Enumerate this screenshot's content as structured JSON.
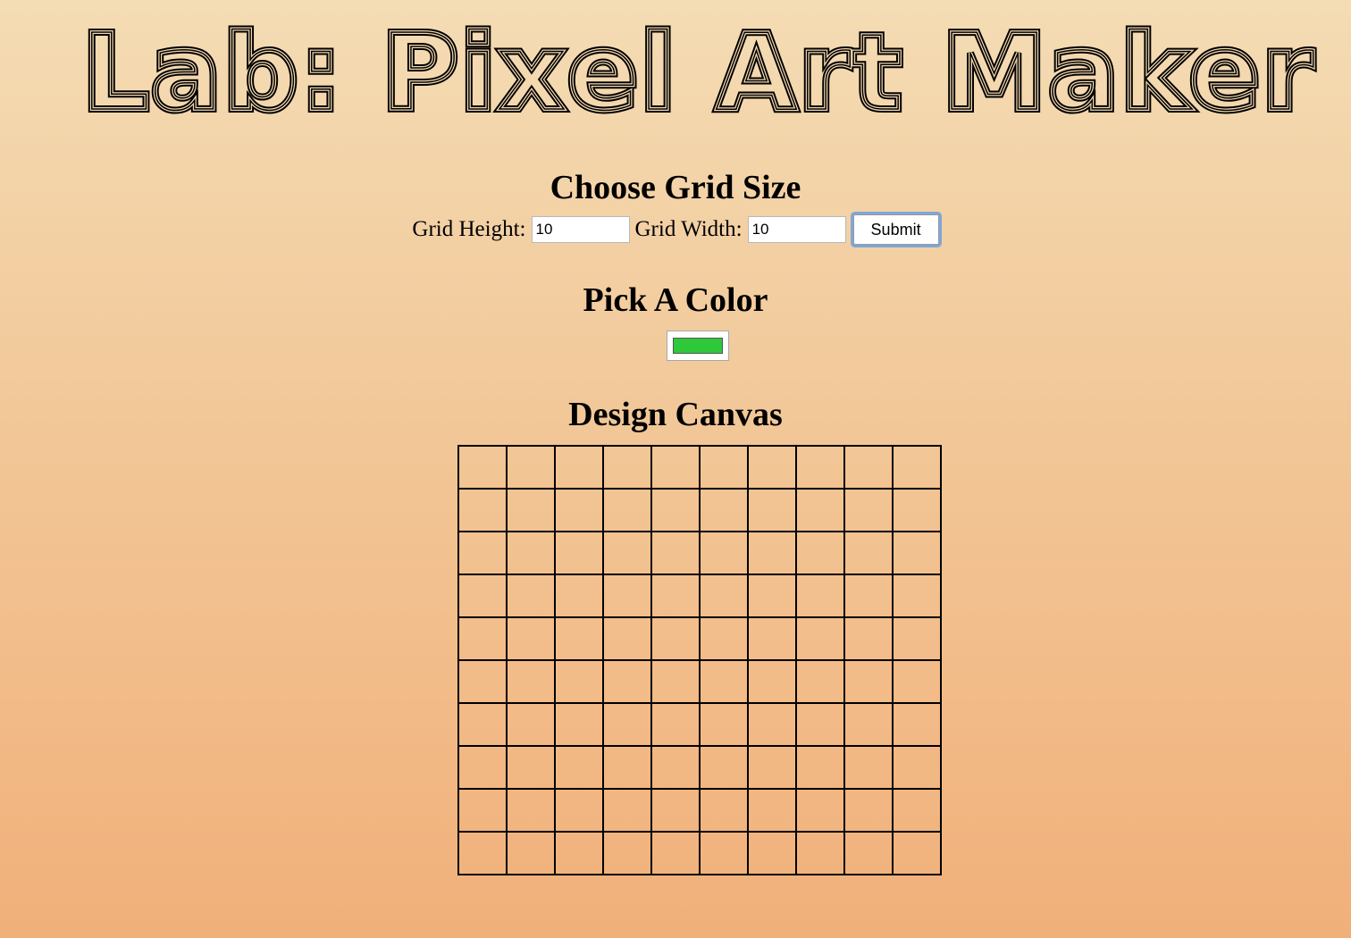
{
  "page": {
    "title": "Lab: Pixel Art Maker"
  },
  "grid_size": {
    "heading": "Choose Grid Size",
    "height_label": "Grid Height:",
    "height_value": "10",
    "width_label": "Grid Width:",
    "width_value": "10",
    "submit_label": "Submit"
  },
  "color": {
    "heading": "Pick A Color",
    "value": "#2dc93a"
  },
  "canvas": {
    "heading": "Design Canvas",
    "rows": 10,
    "columns": 10
  }
}
